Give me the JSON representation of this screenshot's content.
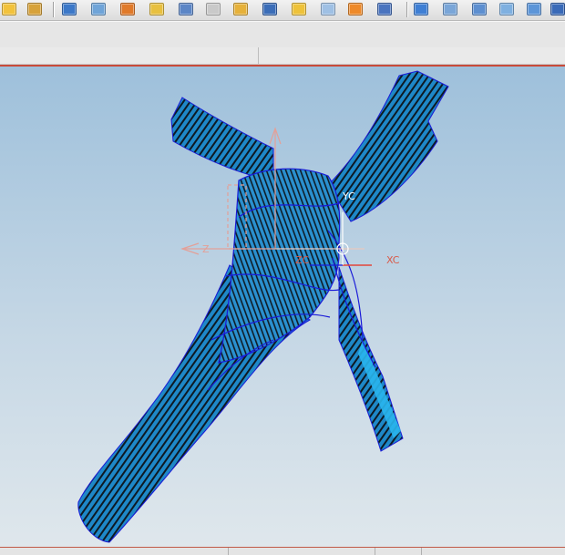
{
  "toolbar": {
    "buttons": [
      {
        "icon": "open-icon",
        "color": "#f2c23c"
      },
      {
        "icon": "save-as-icon",
        "color": "#d7a23a"
      },
      {
        "icon": "view-icon",
        "color": "#3c78c8"
      },
      {
        "icon": "sketch-icon",
        "color": "#6fa4d8"
      },
      {
        "icon": "block-icon",
        "color": "#e07a2a"
      },
      {
        "icon": "pencil-icon",
        "color": "#e8c040"
      },
      {
        "icon": "revolve-icon",
        "color": "#5c86c6"
      },
      {
        "icon": "box-icon",
        "color": "#c9c9c9"
      },
      {
        "icon": "extrude-icon",
        "color": "#e6b13a"
      },
      {
        "icon": "pipe-icon",
        "color": "#3b6db8"
      },
      {
        "icon": "cube-icon",
        "color": "#eec23a"
      },
      {
        "icon": "plane-icon",
        "color": "#9fc0e4"
      },
      {
        "icon": "blend-icon",
        "color": "#ee8a2a"
      },
      {
        "icon": "surface-icon",
        "color": "#4a74bf"
      },
      {
        "icon": "pattern-icon",
        "color": "#3f7fd4"
      },
      {
        "icon": "layers-icon",
        "color": "#7aa6d8"
      },
      {
        "icon": "copy-icon",
        "color": "#5d8fd0"
      },
      {
        "icon": "panel-icon",
        "color": "#7fb0e0"
      },
      {
        "icon": "window-icon",
        "color": "#5c95d8"
      },
      {
        "icon": "more-icon",
        "color": "#3a6ab8"
      }
    ]
  },
  "viewport": {
    "model_colors": {
      "fill": "#1e88c8",
      "edge": "#1a1ad8",
      "stripe": "#101820",
      "highlight": "#29b6ee"
    },
    "axis_color": "#d95b4a",
    "axes": {
      "x_label": "XC",
      "y_label": "YC",
      "z_label": "ZC"
    }
  }
}
